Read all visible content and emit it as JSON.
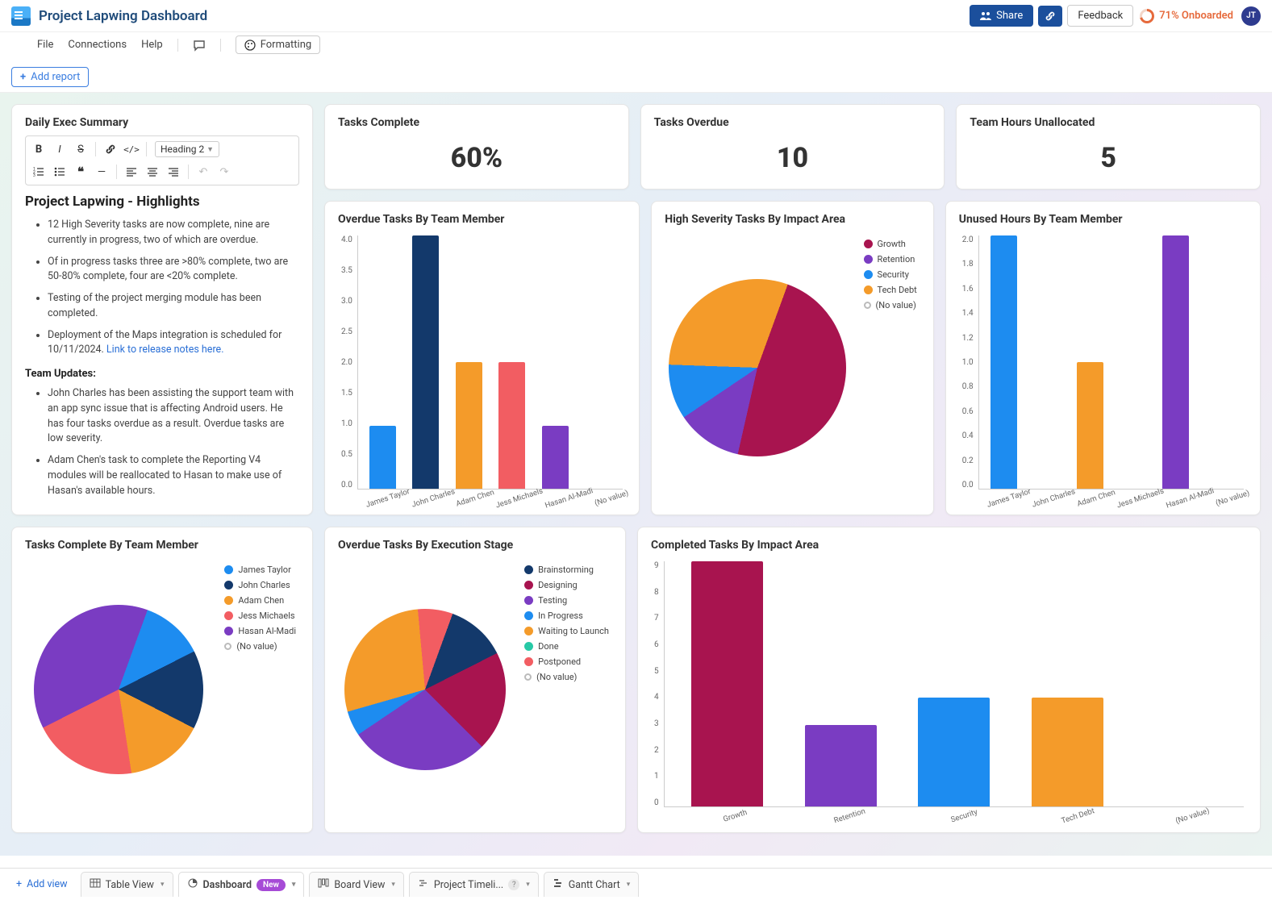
{
  "header": {
    "title": "Project Lapwing Dashboard",
    "share": "Share",
    "feedback": "Feedback",
    "onboarded": "71% Onboarded",
    "avatar": "JT"
  },
  "menu": {
    "file": "File",
    "connections": "Connections",
    "help": "Help",
    "formatting": "Formatting"
  },
  "add_report": "Add report",
  "summary": {
    "title": "Daily Exec Summary",
    "heading_select": "Heading 2",
    "h2": "Project Lapwing - Highlights",
    "bullets1": [
      "12 High Severity tasks are now complete, nine are currently in progress, two of which are overdue.",
      "Of in progress tasks three are >80% complete,  two are      50-80% complete, four are <20% complete.",
      "Testing of the project merging module has been completed.",
      "Deployment of the Maps integration is scheduled for 10/11/2024."
    ],
    "link1": "Link to release notes here.",
    "team_updates_label": "Team Updates:",
    "bullets2": [
      "John Charles has been assisting the support team with an app sync issue that is affecting Android users. He has four tasks overdue as a result. Overdue tasks are low severity.",
      "Adam Chen's task to complete the Reporting V4 modules will be reallocated to Hasan to make use of Hasan's available hours."
    ]
  },
  "metrics": {
    "tasks_complete": {
      "title": "Tasks Complete",
      "value": "60%"
    },
    "tasks_overdue": {
      "title": "Tasks Overdue",
      "value": "10"
    },
    "team_hours": {
      "title": "Team Hours Unallocated",
      "value": "5"
    }
  },
  "colors": {
    "blue": "#1d8cf0",
    "navy": "#13396b",
    "orange": "#f49b2a",
    "coral": "#f25d62",
    "purple": "#7a3cc2",
    "magenta": "#a8144f",
    "teal": "#27c9a6"
  },
  "legend_labels": {
    "no_value": "(No value)"
  },
  "chart_data": [
    {
      "id": "overdue_by_member",
      "type": "bar",
      "title": "Overdue Tasks By Team Member",
      "categories": [
        "James Taylor",
        "John Charles",
        "Adam Chen",
        "Jess Michaels",
        "Hasan Al-Madi",
        "(No value)"
      ],
      "values": [
        1,
        4,
        2,
        2,
        1,
        0
      ],
      "colors": [
        "blue",
        "navy",
        "orange",
        "coral",
        "purple",
        "gray"
      ],
      "ylim": [
        0,
        4
      ],
      "ystep": 0.5
    },
    {
      "id": "high_severity_pie",
      "type": "pie",
      "title": "High Severity Tasks By Impact Area",
      "series": [
        {
          "name": "Growth",
          "value": 48,
          "color": "magenta"
        },
        {
          "name": "Retention",
          "value": 12,
          "color": "purple"
        },
        {
          "name": "Security",
          "value": 10,
          "color": "blue"
        },
        {
          "name": "Tech Debt",
          "value": 30,
          "color": "orange"
        },
        {
          "name": "(No value)",
          "value": 0,
          "color": "hollow"
        }
      ]
    },
    {
      "id": "unused_hours",
      "type": "bar",
      "title": "Unused Hours By Team Member",
      "categories": [
        "James Taylor",
        "John Charles",
        "Adam Chen",
        "Jess Michaels",
        "Hasan Al-Madi",
        "(No value)"
      ],
      "values": [
        2,
        0,
        1,
        0,
        2,
        0
      ],
      "colors": [
        "blue",
        "navy",
        "orange",
        "coral",
        "purple",
        "gray"
      ],
      "ylim": [
        0,
        2
      ],
      "ystep": 0.2
    },
    {
      "id": "tasks_complete_pie",
      "type": "pie",
      "title": "Tasks Complete By Team Member",
      "series": [
        {
          "name": "James Taylor",
          "value": 12,
          "color": "blue"
        },
        {
          "name": "John Charles",
          "value": 15,
          "color": "navy"
        },
        {
          "name": "Adam Chen",
          "value": 15,
          "color": "orange"
        },
        {
          "name": "Jess Michaels",
          "value": 20,
          "color": "coral"
        },
        {
          "name": "Hasan Al-Madi",
          "value": 38,
          "color": "purple"
        },
        {
          "name": "(No value)",
          "value": 0,
          "color": "hollow"
        }
      ]
    },
    {
      "id": "overdue_by_stage_pie",
      "type": "pie",
      "title": "Overdue Tasks By Execution Stage",
      "series": [
        {
          "name": "Brainstorming",
          "value": 12,
          "color": "navy"
        },
        {
          "name": "Designing",
          "value": 20,
          "color": "magenta"
        },
        {
          "name": "Testing",
          "value": 28,
          "color": "purple"
        },
        {
          "name": "In Progress",
          "value": 5,
          "color": "blue"
        },
        {
          "name": "Waiting to Launch",
          "value": 28,
          "color": "orange"
        },
        {
          "name": "Done",
          "value": 0,
          "color": "teal"
        },
        {
          "name": "Postponed",
          "value": 7,
          "color": "coral"
        },
        {
          "name": "(No value)",
          "value": 0,
          "color": "hollow"
        }
      ]
    },
    {
      "id": "completed_by_area",
      "type": "bar",
      "title": "Completed Tasks By Impact Area",
      "categories": [
        "Growth",
        "Retention",
        "Security",
        "Tech Debt",
        "(No value)"
      ],
      "values": [
        9,
        3,
        4,
        4,
        0
      ],
      "colors": [
        "magenta",
        "purple",
        "blue",
        "orange",
        "gray"
      ],
      "ylim": [
        0,
        9
      ],
      "ystep": 1
    }
  ],
  "tabs": {
    "add_view": "Add view",
    "items": [
      {
        "label": "Table View",
        "icon": "table"
      },
      {
        "label": "Dashboard",
        "icon": "dashboard",
        "badge": "New",
        "active": true
      },
      {
        "label": "Board View",
        "icon": "board"
      },
      {
        "label": "Project Timeli...",
        "icon": "timeline",
        "help": true
      },
      {
        "label": "Gantt Chart",
        "icon": "gantt"
      }
    ]
  }
}
